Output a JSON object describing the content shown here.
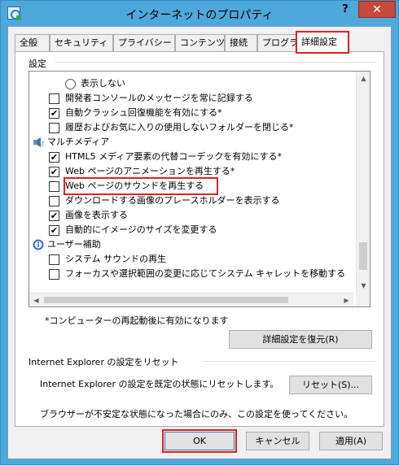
{
  "window": {
    "title": "インターネットのプロパティ",
    "help": "?",
    "close": "✕"
  },
  "tabs": [
    {
      "label": "全般"
    },
    {
      "label": "セキュリティ"
    },
    {
      "label": "プライバシー"
    },
    {
      "label": "コンテンツ"
    },
    {
      "label": "接続"
    },
    {
      "label": "プログラム"
    },
    {
      "label": "詳細設定"
    }
  ],
  "settings": {
    "group_label": "設定",
    "items": [
      {
        "type": "radio",
        "label": "表示しない",
        "checked": false
      },
      {
        "type": "checkbox",
        "label": "開発者コンソールのメッセージを常に記録する",
        "checked": false
      },
      {
        "type": "checkbox",
        "label": "自動クラッシュ回復機能を有効にする*",
        "checked": true
      },
      {
        "type": "checkbox",
        "label": "履歴およびお気に入りの使用しないフォルダーを閉じる*",
        "checked": false
      },
      {
        "type": "category",
        "label": "マルチメディア",
        "icon": "multimedia-icon"
      },
      {
        "type": "checkbox",
        "label": "HTML5 メディア要素の代替コーデックを有効にする*",
        "checked": true
      },
      {
        "type": "checkbox",
        "label": "Web ページのアニメーションを再生する*",
        "checked": true
      },
      {
        "type": "checkbox",
        "label": "Web ページのサウンドを再生する",
        "checked": false
      },
      {
        "type": "checkbox",
        "label": "ダウンロードする画像のプレースホルダーを表示する",
        "checked": false
      },
      {
        "type": "checkbox",
        "label": "画像を表示する",
        "checked": true
      },
      {
        "type": "checkbox",
        "label": "自動的にイメージのサイズを変更する",
        "checked": true
      },
      {
        "type": "category",
        "label": "ユーザー補助",
        "icon": "accessibility-icon"
      },
      {
        "type": "checkbox",
        "label": "システム サウンドの再生",
        "checked": false
      },
      {
        "type": "checkbox",
        "label": "フォーカスや選択範囲の変更に応じてシステム キャレットを移動する",
        "checked": false
      }
    ],
    "note": "*コンピューターの再起動後に有効になります",
    "restore_button": "詳細設定を復元(R)"
  },
  "reset": {
    "group_label": "Internet Explorer の設定をリセット",
    "description": "Internet Explorer の設定を既定の状態にリセットします。",
    "button": "リセット(S)...",
    "hint": "ブラウザーが不安定な状態になった場合にのみ、この設定を使ってください。"
  },
  "footer": {
    "ok": "OK",
    "cancel": "キャンセル",
    "apply": "適用(A)"
  },
  "colors": {
    "highlight": "#e02020",
    "window_frame": "#4fa8dc",
    "close_button": "#c7483d"
  }
}
